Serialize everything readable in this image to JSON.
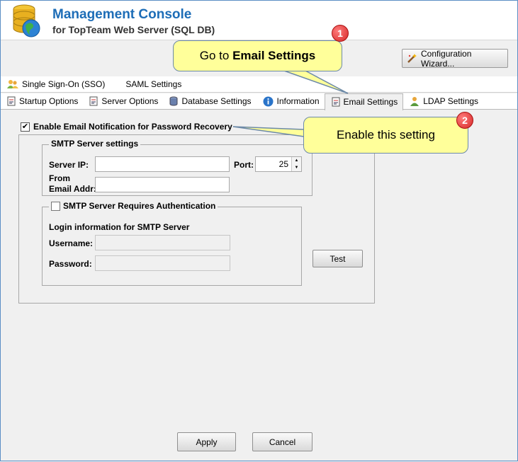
{
  "header": {
    "title": "Management Console",
    "subtitle": "for TopTeam Web Server (SQL DB)"
  },
  "toolbar": {
    "wizard_label": "Configuration Wizard..."
  },
  "tabs_row1": [
    {
      "label": "Single Sign-On (SSO)",
      "icon": "users-icon"
    },
    {
      "label": "SAML Settings",
      "icon": ""
    }
  ],
  "tabs_row2": [
    {
      "label": "Startup Options",
      "icon": "document-icon"
    },
    {
      "label": "Server Options",
      "icon": "document-icon"
    },
    {
      "label": "Database Settings",
      "icon": "database-icon"
    },
    {
      "label": "Information",
      "icon": "info-icon"
    },
    {
      "label": "Email Settings",
      "icon": "document-icon",
      "active": true
    },
    {
      "label": "LDAP Settings",
      "icon": "user-icon"
    }
  ],
  "email": {
    "enable_label": "Enable Email Notification for Password Recovery",
    "enable_checked": true,
    "smtp_group": "SMTP Server settings",
    "server_ip_label": "Server IP:",
    "server_ip_value": "",
    "port_label": "Port:",
    "port_value": "25",
    "from_label_line1": "From",
    "from_label_line2": "Email Addr:",
    "from_value": "",
    "auth_group": "SMTP Server Requires Authentication",
    "auth_checked": false,
    "login_info": "Login information for SMTP Server",
    "username_label": "Username:",
    "password_label": "Password:",
    "test_label": "Test"
  },
  "footer": {
    "apply_label": "Apply",
    "cancel_label": "Cancel"
  },
  "callouts": {
    "c1_prefix": "Go to ",
    "c1_bold": "Email Settings",
    "c1_badge": "1",
    "c2_text": "Enable this setting",
    "c2_badge": "2"
  },
  "colors": {
    "title": "#1d6db7",
    "callout_fill": "#ffff9a",
    "badge": "#d62828"
  }
}
